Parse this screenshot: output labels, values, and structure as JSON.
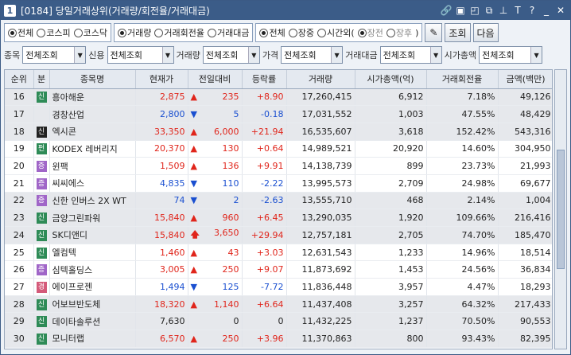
{
  "window": {
    "num": "1",
    "title": "[0184] 당일거래상위(거래량/회전율/거래대금)"
  },
  "toolbar_icons": [
    "link-icon",
    "memo-icon",
    "window-icon",
    "copy-icon",
    "pin-icon",
    "font-icon",
    "help-icon",
    "minimize-icon",
    "close-icon"
  ],
  "filters": {
    "market": [
      "전체",
      "코스피",
      "코스닥"
    ],
    "sort": [
      "거래량",
      "거래회전율",
      "거래대금"
    ],
    "session": [
      "전체",
      "장중",
      "시간외(",
      "장전",
      "장후",
      ")"
    ],
    "btn_query": "조회",
    "btn_next": "다음"
  },
  "selects": [
    {
      "label": "종목",
      "value": "전체조회"
    },
    {
      "label": "신용",
      "value": "전체조회"
    },
    {
      "label": "거래량",
      "value": "전체조회"
    },
    {
      "label": "가격",
      "value": "전체조회"
    },
    {
      "label": "거래대금",
      "value": "전체조회"
    },
    {
      "label": "시가총액",
      "value": "전체조회"
    }
  ],
  "columns": [
    "순위",
    "분",
    "종목명",
    "현재가",
    "전일대비",
    "등락률",
    "거래량",
    "시가총액(억)",
    "거래회전율",
    "금액(백만)"
  ],
  "colors": {
    "up": "#e0251b",
    "down": "#1a4fd0",
    "badge_green": "#2e8b57",
    "badge_purple": "#a066c8",
    "badge_black": "#222222",
    "badge_pink": "#d45a7a"
  },
  "rows": [
    {
      "rank": "16",
      "badge": "신",
      "bc": "#2e8b57",
      "name": "흥아해운",
      "price": "2,875",
      "dir": "up",
      "chg": "235",
      "rate": "+8.90",
      "vol": "17,260,415",
      "cap": "6,912",
      "turn": "7.18%",
      "amt": "49,126",
      "shade": true
    },
    {
      "rank": "17",
      "badge": "",
      "bc": "",
      "name": "경창산업",
      "price": "2,800",
      "dir": "dn",
      "chg": "5",
      "rate": "-0.18",
      "vol": "17,031,552",
      "cap": "1,003",
      "turn": "47.55%",
      "amt": "48,429",
      "shade": true
    },
    {
      "rank": "18",
      "badge": "신",
      "bc": "#222222",
      "name": "엑시콘",
      "price": "33,350",
      "dir": "up",
      "chg": "6,000",
      "rate": "+21.94",
      "vol": "16,535,607",
      "cap": "3,618",
      "turn": "152.42%",
      "amt": "543,316",
      "shade": true
    },
    {
      "rank": "19",
      "badge": "펀",
      "bc": "#2e8b57",
      "name": "KODEX 레버리지",
      "price": "20,370",
      "dir": "up",
      "chg": "130",
      "rate": "+0.64",
      "vol": "14,989,521",
      "cap": "20,920",
      "turn": "14.60%",
      "amt": "304,950",
      "shade": false
    },
    {
      "rank": "20",
      "badge": "증",
      "bc": "#a066c8",
      "name": "윈팩",
      "price": "1,509",
      "dir": "up",
      "chg": "136",
      "rate": "+9.91",
      "vol": "14,138,739",
      "cap": "899",
      "turn": "23.73%",
      "amt": "21,993",
      "shade": false
    },
    {
      "rank": "21",
      "badge": "증",
      "bc": "#a066c8",
      "name": "씨씨에스",
      "price": "4,835",
      "dir": "dn",
      "chg": "110",
      "rate": "-2.22",
      "vol": "13,995,573",
      "cap": "2,709",
      "turn": "24.98%",
      "amt": "69,677",
      "shade": false
    },
    {
      "rank": "22",
      "badge": "증",
      "bc": "#a066c8",
      "name": "신한 인버스 2X WT",
      "price": "74",
      "dir": "dn",
      "chg": "2",
      "rate": "-2.63",
      "vol": "13,555,710",
      "cap": "468",
      "turn": "2.14%",
      "amt": "1,004",
      "shade": true
    },
    {
      "rank": "23",
      "badge": "신",
      "bc": "#2e8b57",
      "name": "금양그린파워",
      "price": "15,840",
      "dir": "up",
      "chg": "960",
      "rate": "+6.45",
      "vol": "13,290,035",
      "cap": "1,920",
      "turn": "109.66%",
      "amt": "216,416",
      "shade": true
    },
    {
      "rank": "24",
      "badge": "신",
      "bc": "#2e8b57",
      "name": "SK디앤디",
      "price": "15,840",
      "dir": "upl",
      "chg": "3,650",
      "rate": "+29.94",
      "vol": "12,757,181",
      "cap": "2,705",
      "turn": "74.70%",
      "amt": "185,470",
      "shade": true
    },
    {
      "rank": "25",
      "badge": "신",
      "bc": "#2e8b57",
      "name": "엘컴텍",
      "price": "1,460",
      "dir": "up",
      "chg": "43",
      "rate": "+3.03",
      "vol": "12,631,543",
      "cap": "1,233",
      "turn": "14.96%",
      "amt": "18,514",
      "shade": false
    },
    {
      "rank": "26",
      "badge": "증",
      "bc": "#a066c8",
      "name": "심텍홀딩스",
      "price": "3,005",
      "dir": "up",
      "chg": "250",
      "rate": "+9.07",
      "vol": "11,873,692",
      "cap": "1,453",
      "turn": "24.56%",
      "amt": "36,834",
      "shade": false
    },
    {
      "rank": "27",
      "badge": "경",
      "bc": "#d45a7a",
      "name": "에이프로젠",
      "price": "1,494",
      "dir": "dn",
      "chg": "125",
      "rate": "-7.72",
      "vol": "11,836,448",
      "cap": "3,957",
      "turn": "4.47%",
      "amt": "18,293",
      "shade": false
    },
    {
      "rank": "28",
      "badge": "신",
      "bc": "#2e8b57",
      "name": "어보브반도체",
      "price": "18,320",
      "dir": "up",
      "chg": "1,140",
      "rate": "+6.64",
      "vol": "11,437,408",
      "cap": "3,257",
      "turn": "64.32%",
      "amt": "217,433",
      "shade": true
    },
    {
      "rank": "29",
      "badge": "신",
      "bc": "#2e8b57",
      "name": "데이타솔루션",
      "price": "7,630",
      "dir": "zero",
      "chg": "0",
      "rate": "0",
      "vol": "11,432,225",
      "cap": "1,237",
      "turn": "70.50%",
      "amt": "90,553",
      "shade": true
    },
    {
      "rank": "30",
      "badge": "신",
      "bc": "#2e8b57",
      "name": "모니터랩",
      "price": "6,570",
      "dir": "up",
      "chg": "250",
      "rate": "+3.96",
      "vol": "11,370,863",
      "cap": "800",
      "turn": "93.43%",
      "amt": "82,395",
      "shade": true
    }
  ]
}
